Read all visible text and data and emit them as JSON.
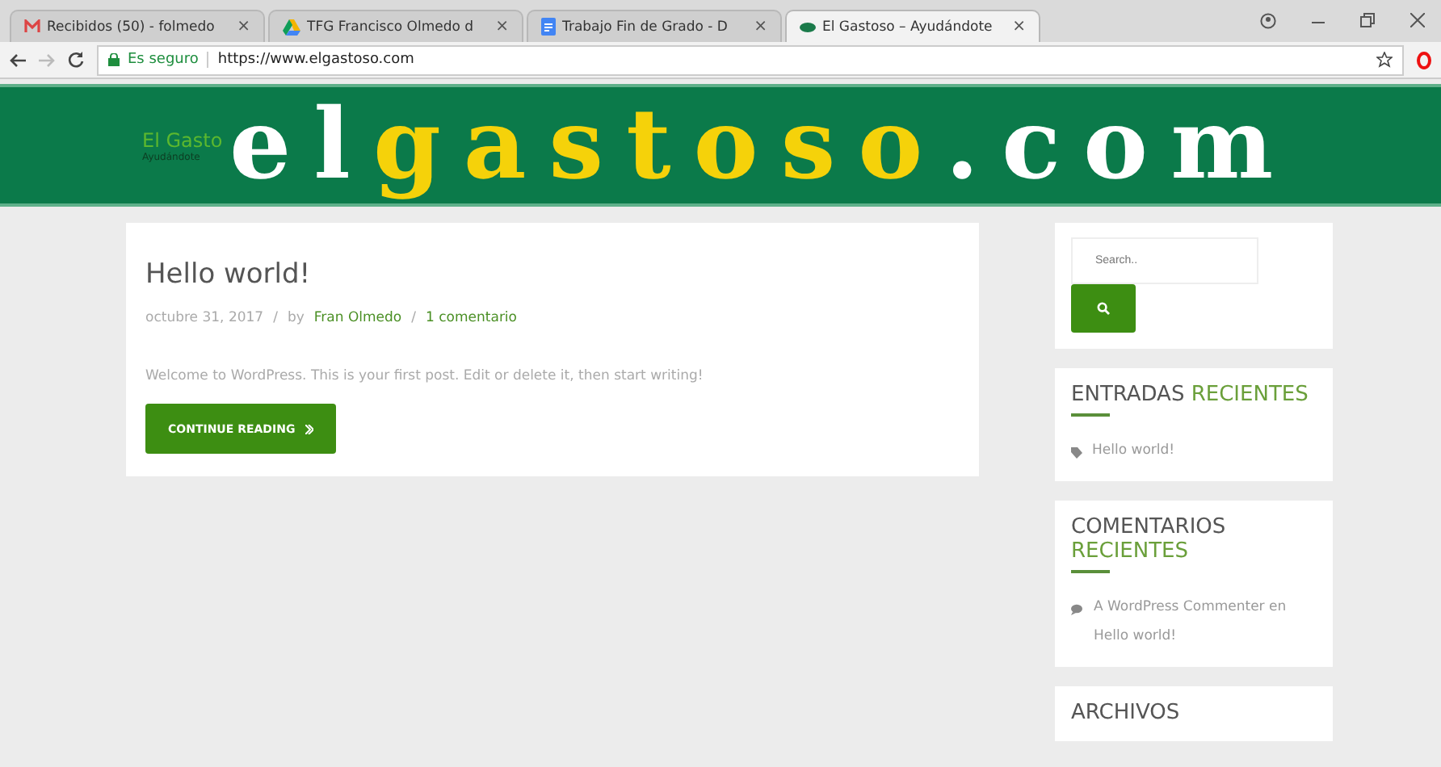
{
  "browser": {
    "tabs": [
      {
        "kind": "mail",
        "title": "Recibidos (50) - folmedo",
        "selected": false
      },
      {
        "kind": "drive",
        "title": "TFG Francisco Olmedo d",
        "selected": false
      },
      {
        "kind": "doc",
        "title": "Trabajo Fin de Grado - D",
        "selected": false
      },
      {
        "kind": "dot",
        "title": "El Gastoso – Ayudándote",
        "selected": true
      }
    ],
    "close_glyph": "×",
    "secure_label": "Es seguro",
    "url": "https://www.elgastoso.com"
  },
  "header": {
    "site_title": "El Gasto",
    "tagline": "Ayudándote",
    "logo": [
      {
        "text": "el",
        "kind": "plain"
      },
      {
        "text": "gastoso",
        "kind": "accent"
      },
      {
        "text": ".com",
        "kind": "plain"
      }
    ]
  },
  "post": {
    "title": "Hello world!",
    "date": "octubre 31, 2017",
    "separator": "/",
    "by": "by",
    "author": "Fran Olmedo",
    "comments": "1 comentario",
    "excerpt": "Welcome to WordPress. This is your first post. Edit or delete it, then start writing!",
    "button": "CONTINUE READING"
  },
  "sidebar": {
    "search_placeholder": "Search..",
    "widgets": [
      {
        "title": "ENTRADAS",
        "accent": "RECIENTES",
        "kind": "tag",
        "items": [
          "Hello world!"
        ]
      },
      {
        "title": "COMENTARIOS",
        "accent": "RECIENTES",
        "kind": "comment",
        "items": [
          "A WordPress Commenter en Hello world!"
        ]
      },
      {
        "title": "ARCHIVOS"
      }
    ]
  }
}
